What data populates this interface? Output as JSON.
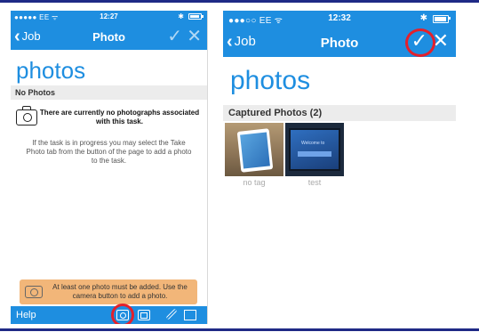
{
  "left": {
    "status": {
      "carrier": "●●●●● EE ᯤ",
      "time": "12:27",
      "bluetooth": "✱"
    },
    "nav": {
      "back": "Job",
      "title": "Photo",
      "check_icon": "checkmark-icon",
      "close_icon": "close-icon"
    },
    "heading": "photos",
    "section": "No Photos",
    "empty_message": "There are currently no photographs associated with this task.",
    "help_text": "If the task is in progress you may select the Take Photo tab from the button of the page to add a photo to the task.",
    "warning": "At least one photo must be added. Use the camera button to add a photo.",
    "tabbar": {
      "help": "Help",
      "icons": [
        "camera-icon",
        "gallery-icon",
        "pencil-icon",
        "document-icon"
      ]
    }
  },
  "right": {
    "status": {
      "carrier": "●●●○○ EE ᯤ",
      "time": "12:32",
      "bluetooth": "✱"
    },
    "nav": {
      "back": "Job",
      "title": "Photo",
      "check_icon": "checkmark-icon",
      "close_icon": "close-icon"
    },
    "heading": "photos",
    "section": "Captured Photos (2)",
    "photos": [
      {
        "tag": "no tag"
      },
      {
        "tag": "test"
      }
    ]
  },
  "colors": {
    "brand": "#1e8ee0",
    "highlight": "#e3202c",
    "warning_bg": "#f2b679"
  }
}
